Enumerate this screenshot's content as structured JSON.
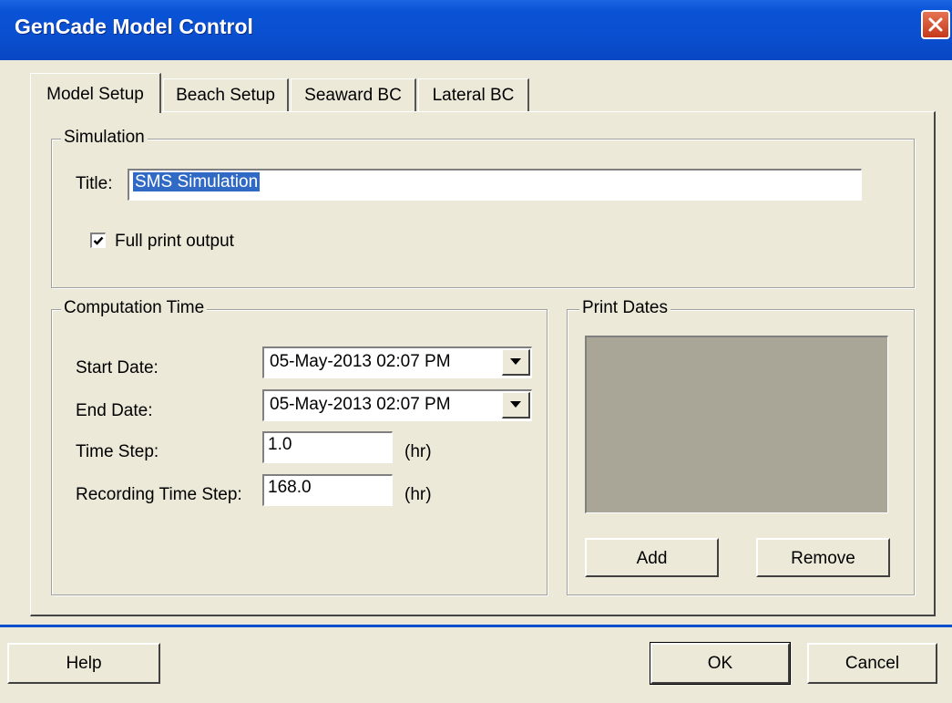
{
  "window": {
    "title": "GenCade Model Control"
  },
  "tabs": [
    {
      "label": "Model Setup"
    },
    {
      "label": "Beach Setup"
    },
    {
      "label": "Seaward BC"
    },
    {
      "label": "Lateral BC"
    }
  ],
  "simulation": {
    "group_label": "Simulation",
    "title_label": "Title:",
    "title_value": "SMS Simulation",
    "full_print_label": "Full print output",
    "full_print_checked": true
  },
  "computation_time": {
    "group_label": "Computation Time",
    "start_date_label": "Start Date:",
    "start_date_value": "05-May-2013 02:07 PM",
    "end_date_label": "End Date:",
    "end_date_value": "05-May-2013 02:07 PM",
    "time_step_label": "Time Step:",
    "time_step_value": "1.0",
    "time_step_unit": "(hr)",
    "recording_step_label": "Recording Time Step:",
    "recording_step_value": "168.0",
    "recording_step_unit": "(hr)"
  },
  "print_dates": {
    "group_label": "Print Dates",
    "add_label": "Add",
    "remove_label": "Remove"
  },
  "footer": {
    "help_label": "Help",
    "ok_label": "OK",
    "cancel_label": "Cancel"
  },
  "icons": {
    "close": "close-icon",
    "checkmark": "checkmark-icon",
    "dropdown": "chevron-down-icon"
  }
}
